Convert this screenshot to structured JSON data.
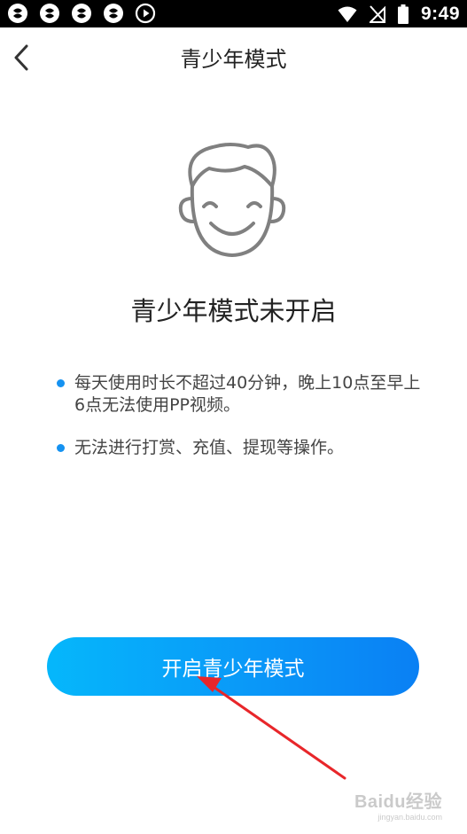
{
  "status_bar": {
    "time": "9:49",
    "left_icons": [
      "app-icon",
      "app-icon",
      "app-icon",
      "app-icon",
      "play-circle-icon"
    ],
    "right_icons": [
      "wifi-icon",
      "no-signal-icon",
      "battery-icon"
    ]
  },
  "nav": {
    "title": "青少年模式",
    "back_icon": "chevron-left-icon"
  },
  "main": {
    "illustration_icon": "smiling-face-icon",
    "heading": "青少年模式未开启",
    "rules": [
      "每天使用时长不超过40分钟，晚上10点至早上6点无法使用PP视频。",
      "无法进行打赏、充值、提现等操作。"
    ],
    "enable_button_label": "开启青少年模式"
  },
  "watermark": {
    "logo": "Baidu经验",
    "url": "jingyan.baidu.com"
  },
  "colors": {
    "accent": "#0a98f8",
    "bullet": "#1592f1",
    "annotation_arrow": "#e8262a",
    "text": "#222222"
  }
}
